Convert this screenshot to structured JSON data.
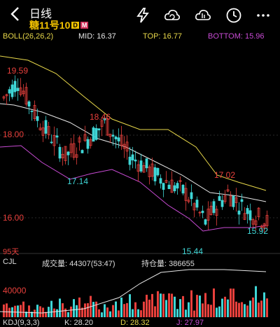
{
  "header": {
    "title": "日线",
    "symbol": "糖11号10",
    "tag_d": "D",
    "tag_m": "M",
    "icons": [
      "back-icon",
      "lightning-icon",
      "cloud-refresh-icon",
      "cloud-chart-icon",
      "clock-icon",
      "more-icon"
    ]
  },
  "indicator": {
    "name": "BOLL(26,26,2)",
    "mid": "MID: 16.37",
    "top": "TOP: 16.77",
    "bottom": "BOTTOM: 15.96"
  },
  "price_axis": [
    "18.00",
    "16.00"
  ],
  "annotations": {
    "high1": "19.59",
    "high2": "18.46",
    "low1": "17.14",
    "high3": "17.02",
    "low2": "15.44",
    "last": "15.92"
  },
  "period_label": "95天",
  "volume": {
    "name": "CJL",
    "turnover": "成交量: 44307(53:47)",
    "open_interest": "持仓量: 386655",
    "axis_value": "40000"
  },
  "kdj": {
    "name": "KDJ(9,3,3)",
    "k": "K: 28.20",
    "d": "D: 28.32",
    "j": "J: 27.97"
  },
  "colors": {
    "up": "#e8403c",
    "down": "#3fd6d6",
    "mid_line": "#e8e8e8",
    "top_line": "#e8d84a",
    "bottom_line": "#c84bd4",
    "tag_d": "#f2c200",
    "tag_m": "#d0305a"
  }
}
